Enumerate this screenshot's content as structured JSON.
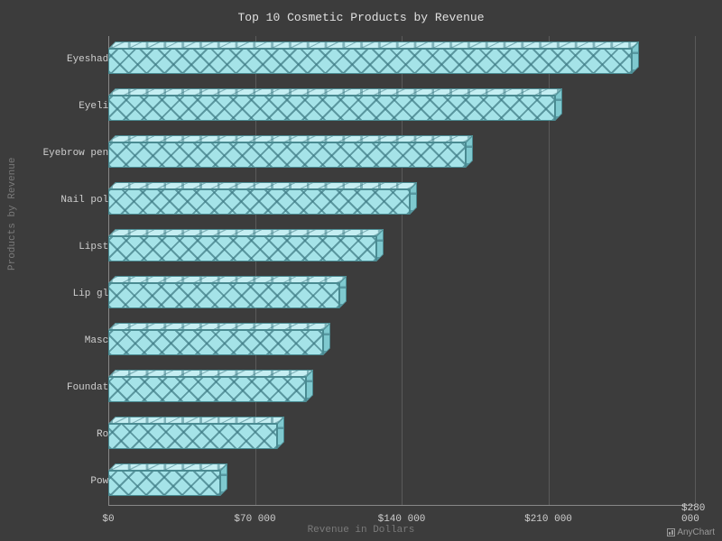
{
  "title": "Top 10 Cosmetic Products by Revenue",
  "y_axis_title": "Products by Revenue",
  "x_axis_title": "Revenue in Dollars",
  "x_ticks": [
    "$0",
    "$70 000",
    "$140 000",
    "$210 000",
    "$280 000"
  ],
  "credit": "AnyChart",
  "chart_data": {
    "type": "bar",
    "orientation": "horizontal",
    "categories": [
      "Eyeshadows",
      "Eyeliner",
      "Eyebrow pencil",
      "Nail polish",
      "Lipstick",
      "Lip gloss",
      "Mascara",
      "Foundation",
      "Rouge",
      "Powder"
    ],
    "values": [
      249980,
      213210,
      170670,
      143760,
      128000,
      110430,
      102610,
      94190,
      80540,
      53540
    ],
    "title": "Top 10 Cosmetic Products by Revenue",
    "xlabel": "Revenue in Dollars",
    "ylabel": "Products by Revenue",
    "xlim": [
      0,
      280000
    ],
    "grid": true
  }
}
